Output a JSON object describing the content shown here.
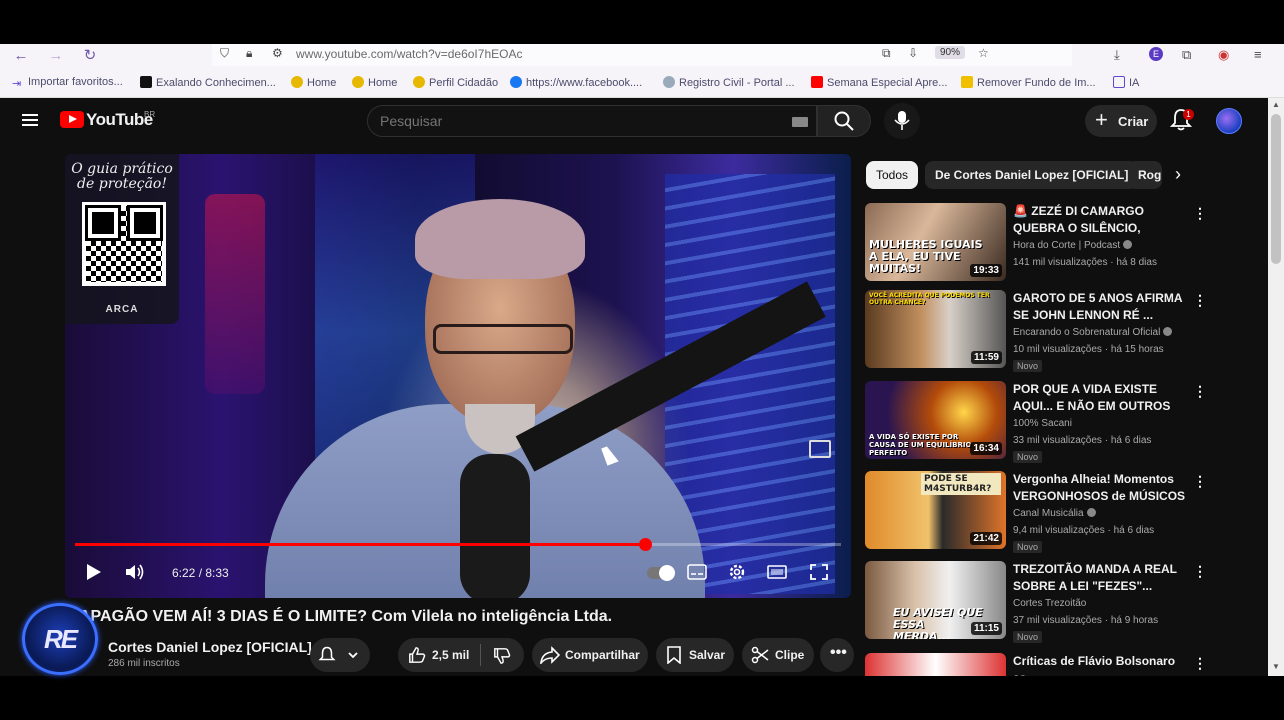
{
  "browser": {
    "url": "www.youtube.com/watch?v=de6oI7hEOAc",
    "zoom": "90%",
    "profile_initial": "E"
  },
  "bookmarks": [
    {
      "label": "Importar favoritos...",
      "color": "#5a4bd6"
    },
    {
      "label": "Exalando Conhecimen...",
      "color": "#111111"
    },
    {
      "label": "Home",
      "color": "#e6b800"
    },
    {
      "label": "Home",
      "color": "#e6b800"
    },
    {
      "label": "Perfil Cidadão",
      "color": "#e6b800"
    },
    {
      "label": "https://www.facebook....",
      "color": "#1877f2"
    },
    {
      "label": "Registro Civil - Portal ...",
      "color": "#9ab"
    },
    {
      "label": "Semana Especial Apre...",
      "color": "#ff0000"
    },
    {
      "label": "Remover Fundo de Im...",
      "color": "#f0c000"
    },
    {
      "label": "IA",
      "color": "#5a4bd6"
    }
  ],
  "youtube": {
    "logo_text": "YouTube",
    "country_code": "BR",
    "search_placeholder": "Pesquisar",
    "create_label": "Criar",
    "notification_count": "1"
  },
  "promo": {
    "line1": "O guia prático",
    "line2": "de proteção!",
    "brand": "ARCA"
  },
  "player": {
    "time": "6:22 / 8:33",
    "progress": 0.744
  },
  "video": {
    "title": "APAGÃO VEM AÍ! 3 DIAS É O LIMITE? Com Vilela no inteligência Ltda.",
    "channel_name": "Cortes Daniel Lopez [OFICIAL]",
    "subscribers": "286 mil inscritos",
    "channel_avatar_text": "RE",
    "likes": "2,5 mil",
    "share_label": "Compartilhar",
    "save_label": "Salvar",
    "clip_label": "Clipe"
  },
  "chips": [
    {
      "label": "Todos",
      "active": true
    },
    {
      "label": "De Cortes Daniel Lopez [OFICIAL]",
      "active": false
    },
    {
      "label": "Rog",
      "active": false
    }
  ],
  "recommendations": [
    {
      "title": "🚨 ZEZÉ DI CAMARGO QUEBRA O SILÊNCIO, ASSUME TRAIÇÃ...",
      "channel": "Hora do Corte | Podcast",
      "verified": true,
      "meta": "141 mil visualizações · há 8 dias",
      "duration": "19:33",
      "badge": "",
      "thumb_text": "MULHERES IGUAIS A ELA, EU TIVE MUITAS!"
    },
    {
      "title": "GAROTO DE 5 ANOS AFIRMA SE JOHN LENNON RÉ ...",
      "channel": "Encarando o Sobrenatural Oficial",
      "verified": true,
      "meta": "10 mil visualizações · há 15 horas",
      "duration": "11:59",
      "badge": "Novo",
      "thumb_text": "VOCÊ ACREDITA QUE PODEMOS TER OUTRA CHANCE?"
    },
    {
      "title": "POR QUE A VIDA EXISTE AQUI... E NÃO EM OUTROS LUGARES?",
      "channel": "100% Sacani",
      "verified": false,
      "meta": "33 mil visualizações · há 6 dias",
      "duration": "16:34",
      "badge": "Novo",
      "thumb_text": "A VIDA SÓ EXISTE POR CAUSA DE UM EQUILÍBRIO PERFEITO"
    },
    {
      "title": "Vergonha Alheia! Momentos VERGONHOSOS de MÚSICOS ...",
      "channel": "Canal Musicália",
      "verified": true,
      "meta": "9,4 mil visualizações · há 6 dias",
      "duration": "21:42",
      "badge": "Novo",
      "thumb_text": "PODE SE M4STURB4R?"
    },
    {
      "title": "TREZOITÃO MANDA A REAL SOBRE A LEI \"FEZES\"...",
      "channel": "Cortes Trezoitão",
      "verified": false,
      "meta": "37 mil visualizações · há 9 horas",
      "duration": "11:15",
      "badge": "Novo",
      "thumb_text": "EU AVISEI QUE ESSA MERDA..."
    },
    {
      "title": "Críticas de Flávio Bolsonaro as ...",
      "channel": "",
      "verified": false,
      "meta": "",
      "duration": "",
      "badge": "",
      "thumb_text": ""
    }
  ],
  "colors": {
    "accent": "#ff0000",
    "background": "#0f0f0f",
    "chip_bg": "#272727"
  }
}
